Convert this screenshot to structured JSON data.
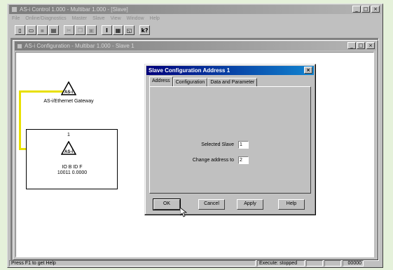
{
  "app": {
    "title": "AS-i Control 1.000 - Multibar 1.000 - [Slave]",
    "menu": [
      "File",
      "Online/Diagnostics",
      "Master",
      "Slave",
      "View",
      "Window",
      "Help"
    ]
  },
  "toolbar": {
    "buttons": [
      "new",
      "open",
      "save",
      "print",
      "cut",
      "copy",
      "paste",
      "info",
      "properties",
      "window",
      "help"
    ]
  },
  "child_window": {
    "title": "AS-i Configuration - Multibar 1.000 - Slave 1"
  },
  "diagram": {
    "gateway_label": "AS-i/Ethernet Gateway",
    "slave_number": "1",
    "slave_io": "IO B ID F",
    "slave_bits": "10011 0.0000"
  },
  "dialog": {
    "title": "Slave Configuration Address 1",
    "tabs": [
      "Address",
      "Configuration",
      "Data and Parameter"
    ],
    "selected_slave_label": "Selected Slave",
    "selected_slave_value": "1",
    "change_address_label": "Change address to",
    "change_address_value": "2",
    "ok_label": "OK",
    "cancel_label": "Cancel",
    "apply_label": "Apply",
    "help_label": "Help"
  },
  "statusbar": {
    "help_text": "Press F1 to get Help",
    "execute_status": "Execute: stopped",
    "counter": "00000"
  },
  "colors": {
    "title_active": "#00007b",
    "background_frame": "#e5f1da",
    "connection_line": "#e8e000"
  }
}
